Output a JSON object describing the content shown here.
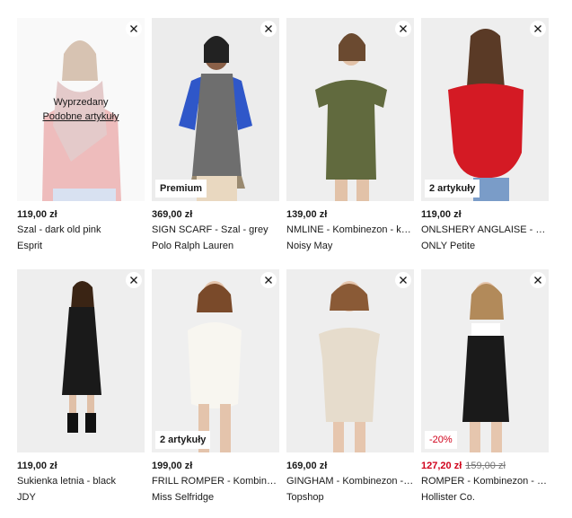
{
  "products": [
    {
      "id": "p1",
      "price": "119,00 zł",
      "name": "Szal - dark old pink",
      "brand": "Esprit",
      "soldout": {
        "label": "Wyprzedany",
        "similar": "Podobne artykuły"
      }
    },
    {
      "id": "p2",
      "price": "369,00 zł",
      "name": "SIGN SCARF - Szal - grey",
      "brand": "Polo Ralph Lauren",
      "badge": "Premium"
    },
    {
      "id": "p3",
      "price": "139,00 zł",
      "name": "NMLINE - Kombinezon - khaki",
      "brand": "Noisy May"
    },
    {
      "id": "p4",
      "price": "119,00 zł",
      "name": "ONLSHERY ANGLAISE - Bluzka - red",
      "brand": "ONLY Petite",
      "badge": "2 artykuły"
    },
    {
      "id": "p5",
      "price": "119,00 zł",
      "name": "Sukienka letnia - black",
      "brand": "JDY"
    },
    {
      "id": "p6",
      "price": "199,00 zł",
      "name": "FRILL ROMPER - Kombinezon - white",
      "brand": "Miss Selfridge",
      "badge": "2 artykuły"
    },
    {
      "id": "p7",
      "price": "169,00 zł",
      "name": "GINGHAM - Kombinezon - beige",
      "brand": "Topshop"
    },
    {
      "id": "p8",
      "price": "127,20 zł",
      "old_price": "159,00 zł",
      "name": "ROMPER - Kombinezon - black",
      "brand": "Hollister Co.",
      "badge": "-20%"
    }
  ],
  "icons": {
    "remove": "close-icon"
  },
  "colors": {
    "sale": "#d0021b",
    "text": "#1a1a1a",
    "image_bg": "#eeeeee"
  }
}
